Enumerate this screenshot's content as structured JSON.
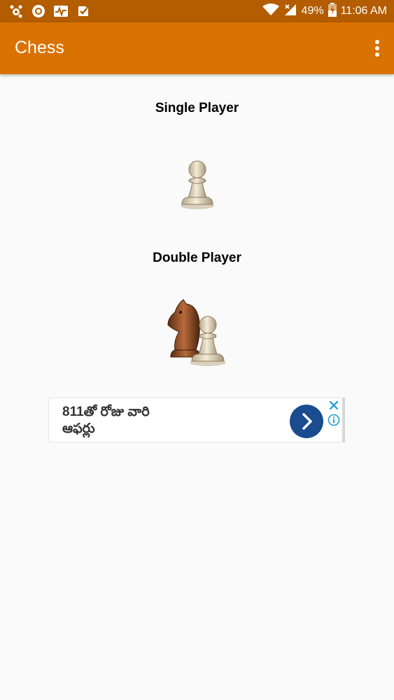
{
  "status_bar": {
    "battery": "49%",
    "time": "11:06 AM"
  },
  "app_bar": {
    "title": "Chess",
    "menu_icon": "more-vert-icon"
  },
  "menu": {
    "single_player_label": "Single Player",
    "single_player_icon": "pawn-icon",
    "double_player_label": "Double Player",
    "double_player_icon": "knight-and-pawn-icon"
  },
  "ad": {
    "text_line1": "811తో రోజు వారి",
    "text_line2": "ఆఫర్లు",
    "arrow_icon": "chevron-right-icon",
    "close_icon": "close-icon",
    "info_icon": "info-icon"
  },
  "colors": {
    "status_bar": "#b35c00",
    "app_bar": "#d97200",
    "background": "#fafafa",
    "ad_button": "#1a4c8f"
  }
}
